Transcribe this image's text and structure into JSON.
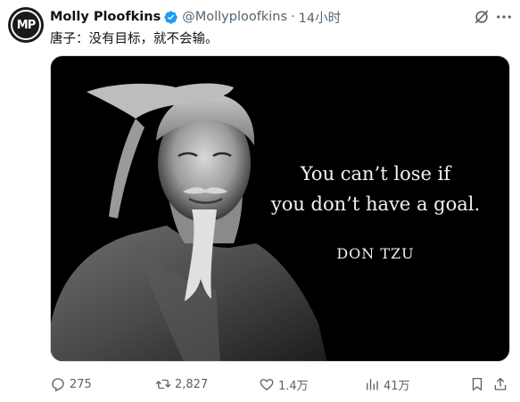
{
  "author": {
    "avatar_text": "MP",
    "display_name": "Molly Ploofkins",
    "handle": "@Mollyploofkins",
    "separator": "·",
    "time": "14小时"
  },
  "tweet": {
    "text": "唐子：没有目标，就不会输。"
  },
  "media": {
    "quote_line1": "You can’t lose if",
    "quote_line2": "you don’t have a goal.",
    "attribution": "DON TZU"
  },
  "actions": {
    "replies": "275",
    "reposts": "2,827",
    "likes": "1.4万",
    "views": "41万"
  },
  "colors": {
    "verified": "#1d9bf0",
    "secondary_text": "#536471",
    "primary_text": "#0f1419"
  }
}
